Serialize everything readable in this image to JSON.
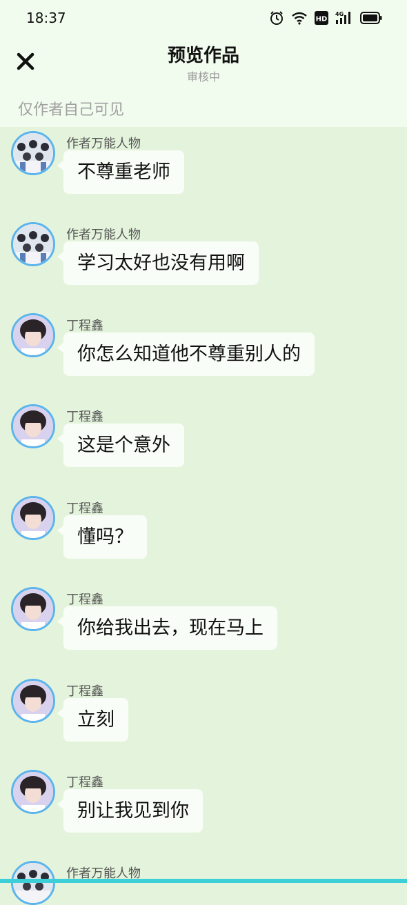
{
  "status_bar": {
    "time": "18:37",
    "icons": [
      "alarm-icon",
      "wifi-icon",
      "hd-icon",
      "signal-4g-icon",
      "battery-icon"
    ],
    "hd_label": "HD",
    "network_label": "4G"
  },
  "header": {
    "close_icon": "close-icon",
    "title": "预览作品",
    "subtitle": "审核中",
    "visibility": "仅作者自己可见"
  },
  "messages": [
    {
      "sender": "作者万能人物",
      "avatar": "group-avatar",
      "text": "不尊重老师"
    },
    {
      "sender": "作者万能人物",
      "avatar": "group-avatar",
      "text": "学习太好也没有用啊"
    },
    {
      "sender": "丁程鑫",
      "avatar": "person-avatar",
      "text": "你怎么知道他不尊重别人的"
    },
    {
      "sender": "丁程鑫",
      "avatar": "person-avatar",
      "text": "这是个意外"
    },
    {
      "sender": "丁程鑫",
      "avatar": "person-avatar",
      "text": "懂吗？"
    },
    {
      "sender": "丁程鑫",
      "avatar": "person-avatar",
      "text": "你给我出去，现在马上"
    },
    {
      "sender": "丁程鑫",
      "avatar": "person-avatar",
      "text": "立刻"
    },
    {
      "sender": "丁程鑫",
      "avatar": "person-avatar",
      "text": "别让我见到你"
    },
    {
      "sender": "作者万能人物",
      "avatar": "group-avatar",
      "text": ""
    }
  ],
  "colors": {
    "background": "#e4f4dc",
    "header_background": "#f2fcee",
    "bubble": "#f9fdf7",
    "avatar_border": "#5bb4ec",
    "bottom_accent": "#3ccfd8"
  }
}
